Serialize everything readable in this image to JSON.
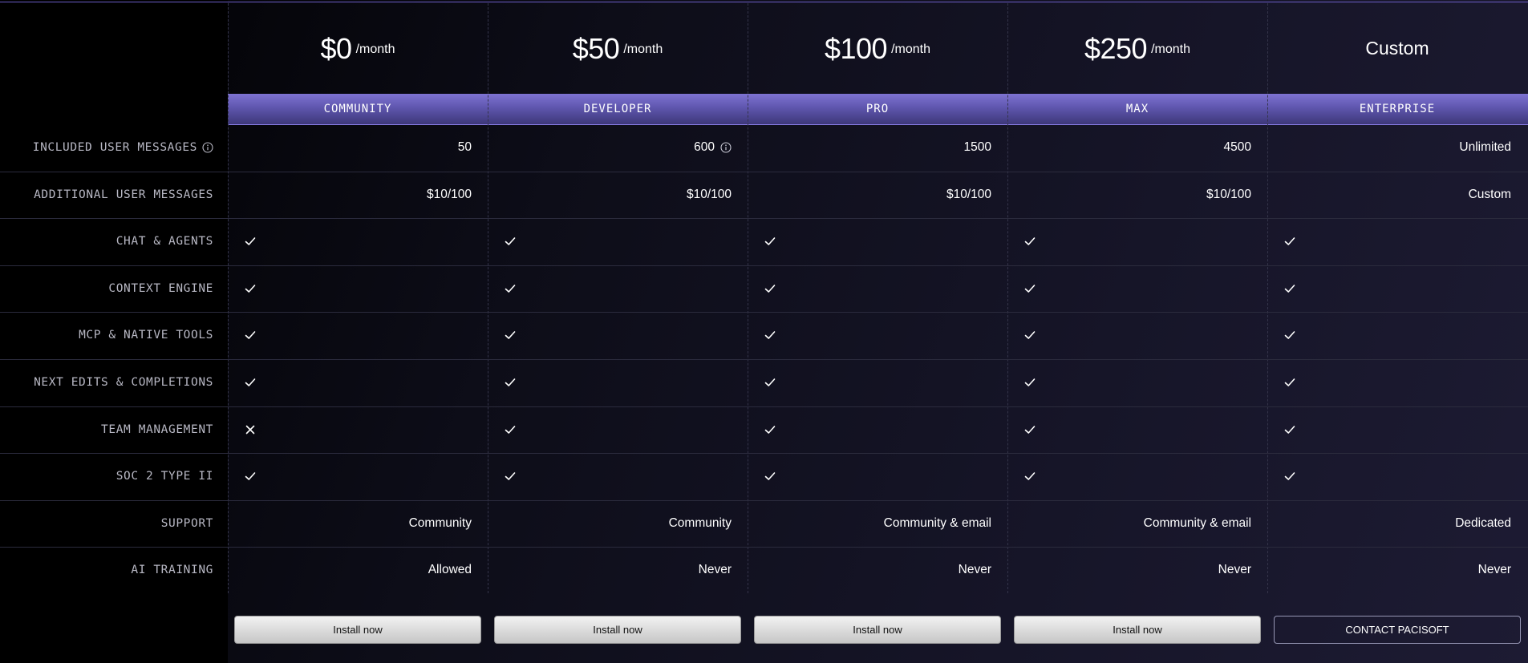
{
  "plans": [
    {
      "price": "$0",
      "period": "/month",
      "tier": "COMMUNITY",
      "button": "Install now"
    },
    {
      "price": "$50",
      "period": "/month",
      "tier": "DEVELOPER",
      "button": "Install now"
    },
    {
      "price": "$100",
      "period": "/month",
      "tier": "PRO",
      "button": "Install now"
    },
    {
      "price": "$250",
      "period": "/month",
      "tier": "MAX",
      "button": "Install now"
    },
    {
      "price": "Custom",
      "period": "",
      "tier": "ENTERPRISE",
      "button": "CONTACT PACISOFT"
    }
  ],
  "rows": [
    {
      "label": "INCLUDED USER MESSAGES",
      "has_info": true,
      "type": "text",
      "values": [
        "50",
        "600",
        "1500",
        "4500",
        "Unlimited"
      ],
      "info_on": [
        false,
        true,
        false,
        false,
        false
      ]
    },
    {
      "label": "ADDITIONAL USER MESSAGES",
      "has_info": false,
      "type": "text",
      "values": [
        "$10/100",
        "$10/100",
        "$10/100",
        "$10/100",
        "Custom"
      ]
    },
    {
      "label": "CHAT & AGENTS",
      "type": "check",
      "values": [
        "check",
        "check",
        "check",
        "check",
        "check"
      ]
    },
    {
      "label": "CONTEXT ENGINE",
      "type": "check",
      "values": [
        "check",
        "check",
        "check",
        "check",
        "check"
      ]
    },
    {
      "label": "MCP & NATIVE TOOLS",
      "type": "check",
      "values": [
        "check",
        "check",
        "check",
        "check",
        "check"
      ]
    },
    {
      "label": "NEXT EDITS & COMPLETIONS",
      "type": "check",
      "values": [
        "check",
        "check",
        "check",
        "check",
        "check"
      ]
    },
    {
      "label": "TEAM MANAGEMENT",
      "type": "check",
      "values": [
        "cross",
        "check",
        "check",
        "check",
        "check"
      ]
    },
    {
      "label": "SOC 2 TYPE II",
      "type": "check",
      "values": [
        "check",
        "check",
        "check",
        "check",
        "check"
      ]
    },
    {
      "label": "SUPPORT",
      "type": "text",
      "values": [
        "Community",
        "Community",
        "Community & email",
        "Community & email",
        "Dedicated"
      ]
    },
    {
      "label": "AI TRAINING",
      "type": "text",
      "values": [
        "Allowed",
        "Never",
        "Never",
        "Never",
        "Never"
      ]
    }
  ],
  "colors": {
    "accent": "#6a5cc4",
    "tier_band": "#5f56ae",
    "background": "#0d0d18"
  },
  "icons": {
    "check": "check-icon",
    "cross": "cross-icon",
    "info": "info-icon"
  }
}
